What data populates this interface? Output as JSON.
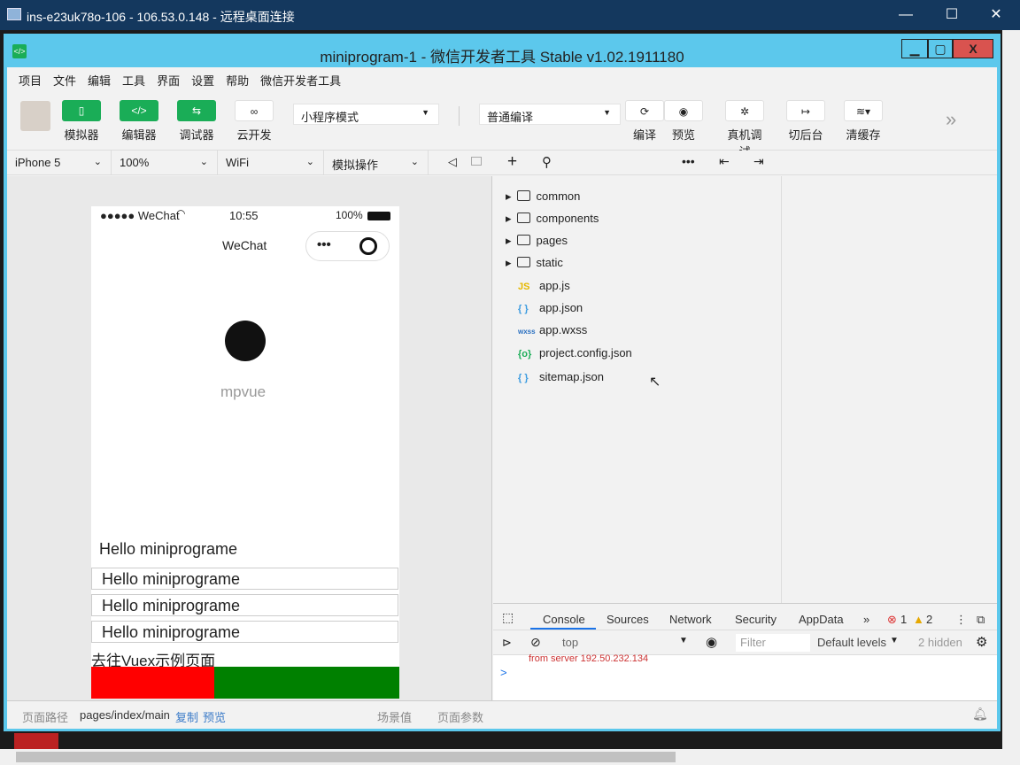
{
  "rdp": {
    "title": "ins-e23uk78o-106 - 106.53.0.148 - 远程桌面连接",
    "min": "—",
    "max": "☐",
    "close": "✕"
  },
  "window": {
    "title": "miniprogram-1 - 微信开发者工具 Stable v1.02.1911180",
    "min": "▁",
    "max": "▢",
    "close": "X"
  },
  "menu": [
    "项目",
    "文件",
    "编辑",
    "工具",
    "界面",
    "设置",
    "帮助",
    "微信开发者工具"
  ],
  "toolbar": {
    "simulator": "模拟器",
    "editor": "编辑器",
    "debugger": "调试器",
    "cloud": "云开发",
    "mode": "小程序模式",
    "compile_mode": "普通编译",
    "compile": "编译",
    "preview": "预览",
    "real_debug": "真机调试",
    "background": "切后台",
    "clear_cache": "清缓存",
    "more": "»"
  },
  "devbar": {
    "device": "iPhone 5",
    "zoom": "100%",
    "network": "WiFi",
    "ops": "模拟操作"
  },
  "phone": {
    "carrier": "●●●●● WeChat",
    "time": "10:55",
    "battery": "100%",
    "nav_title": "WeChat",
    "logo_text": "mpvue",
    "hello": "Hello miniprograme",
    "goto": "去往Vuex示例页面"
  },
  "explorer": {
    "folders": [
      "common",
      "components",
      "pages",
      "static"
    ],
    "files": [
      {
        "icon": "JS",
        "name": "app.js",
        "color": "#e6b800"
      },
      {
        "icon": "{ }",
        "name": "app.json",
        "color": "#3b9be0"
      },
      {
        "icon": "wxss",
        "name": "app.wxss",
        "color": "#2a6fc0"
      },
      {
        "icon": "{o}",
        "name": "project.config.json",
        "color": "#1aad57"
      },
      {
        "icon": "{ }",
        "name": "sitemap.json",
        "color": "#3b9be0"
      }
    ]
  },
  "console": {
    "tabs": [
      "Console",
      "Sources",
      "Network",
      "Security",
      "AppData"
    ],
    "errors": "1",
    "warnings": "2",
    "context": "top",
    "filter": "Filter",
    "levels": "Default levels",
    "hidden": "2 hidden",
    "log": "from server 192.50.232.134",
    "prompt": ">"
  },
  "bottom": {
    "path_label": "页面路径",
    "path": "pages/index/main",
    "copy": "复制",
    "preview": "预览",
    "scene": "场景值",
    "params": "页面参数"
  }
}
